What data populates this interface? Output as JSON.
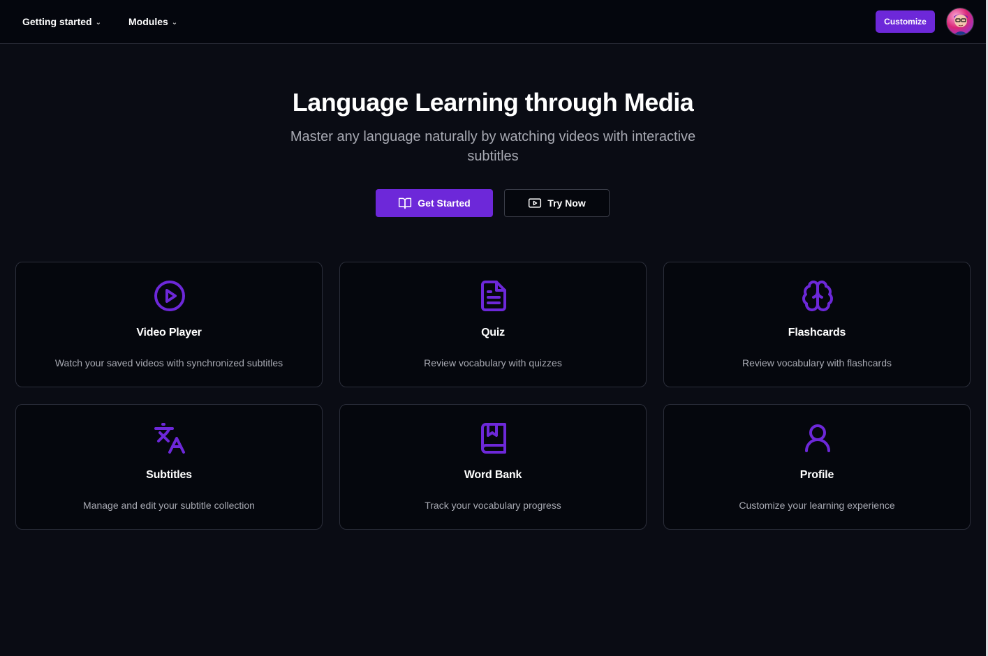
{
  "nav": {
    "getting_started": "Getting started",
    "modules": "Modules",
    "customize": "Customize"
  },
  "hero": {
    "title": "Language Learning through Media",
    "subtitle": "Master any language naturally by watching videos with interactive subtitles",
    "get_started": "Get Started",
    "try_now": "Try Now"
  },
  "cards": [
    {
      "title": "Video Player",
      "desc": "Watch your saved videos with synchronized subtitles",
      "icon": "play-circle-icon"
    },
    {
      "title": "Quiz",
      "desc": "Review vocabulary with quizzes",
      "icon": "file-text-icon"
    },
    {
      "title": "Flashcards",
      "desc": "Review vocabulary with flashcards",
      "icon": "brain-icon"
    },
    {
      "title": "Subtitles",
      "desc": "Manage and edit your subtitle collection",
      "icon": "languages-icon"
    },
    {
      "title": "Word Bank",
      "desc": "Track your vocabulary progress",
      "icon": "book-bookmark-icon"
    },
    {
      "title": "Profile",
      "desc": "Customize your learning experience",
      "icon": "user-icon"
    }
  ],
  "colors": {
    "accent": "#6d28d9",
    "background": "#0a0c14",
    "card": "#05070d",
    "border": "#2b2e3a",
    "muted_text": "#a8aab3"
  }
}
